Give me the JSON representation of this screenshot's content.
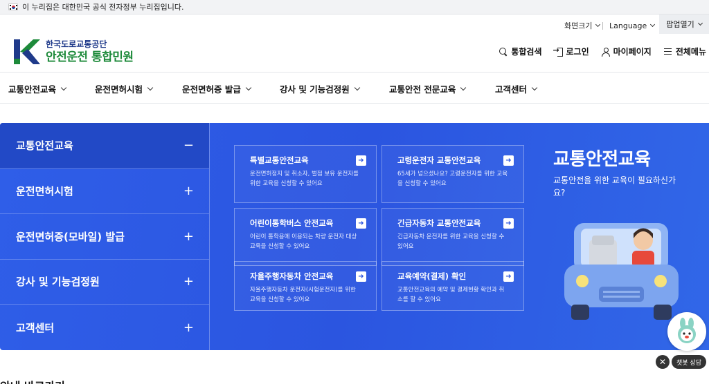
{
  "gov_banner": {
    "text": "이 누리집은 대한민국 공식 전자정부 누리집입니다."
  },
  "utility": {
    "font_size_label": "화면크기",
    "language_label": "Language",
    "popup_label": "팝업열기"
  },
  "logo": {
    "org": "한국도로교통공단",
    "name": "안전운전 통합민원"
  },
  "header_actions": {
    "search": "통합검색",
    "login": "로그인",
    "mypage": "마이페이지",
    "menu": "전체메뉴"
  },
  "gnb": {
    "items": [
      {
        "label": "교통안전교육"
      },
      {
        "label": "운전면허시험"
      },
      {
        "label": "운전면허증 발급"
      },
      {
        "label": "강사 및 기능검정원"
      },
      {
        "label": "교통안전 전문교육"
      },
      {
        "label": "고객센터"
      }
    ]
  },
  "side_menu": {
    "items": [
      {
        "label": "교통안전교육",
        "sign": "−"
      },
      {
        "label": "운전면허시험",
        "sign": "+"
      },
      {
        "label": "운전면허증(모바일) 발급",
        "sign": "+"
      },
      {
        "label": "강사 및 기능검정원",
        "sign": "+"
      },
      {
        "label": "고객센터",
        "sign": "+"
      }
    ]
  },
  "cards": [
    {
      "title": "특별교통안전교육",
      "desc": "운전면허정지 및 취소자, 벌점 보유 운전자를 위한 교육을 신청할 수 있어요"
    },
    {
      "title": "고령운전자 교통안전교육",
      "desc": "65세가 넘으셨나요? 고령운전자를 위한 교육을 신청할 수 있어요"
    },
    {
      "title": "어린이통학버스 안전교육",
      "desc": "어린이 통학용에 이용되는 차량 운전자 대상 교육을 신청할 수 있어요"
    },
    {
      "title": "긴급자동차 교통안전교육",
      "desc": "긴급자동차 운전자를 위한 교육을 신청할 수 있어요"
    },
    {
      "title": "자율주행자동차 안전교육",
      "desc": "자율주행자동차 운전자(시험운전자)를 위한 교육을 신청할 수 있어요"
    },
    {
      "title": "교육예약(결제) 확인",
      "desc": "교통안전교육의 예약 및 결제현황 확인과 취소를 할 수 있어요"
    }
  ],
  "promo": {
    "title": "교통안전교육",
    "subtitle": "교통안전을 위한 교육이 필요하신가요?"
  },
  "chatbot": {
    "label": "챗봇 상담",
    "close": "✕"
  },
  "bottom": {
    "heading": "안내 바로가기"
  },
  "colors": {
    "panel_blue": "#2b55e0",
    "active_side": "#2249c6",
    "logo_green": "#1d8a3a",
    "logo_blue": "#1f3a8a"
  },
  "icons": {
    "search": "search-icon",
    "login": "login-icon",
    "user": "user-icon",
    "menu": "menu-icon",
    "arrow": "arrow-right-icon"
  }
}
